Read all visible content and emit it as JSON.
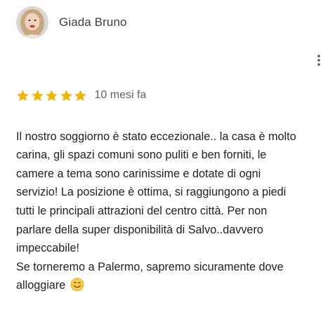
{
  "review": {
    "author": {
      "name": "Giada Bruno",
      "avatar_icon": "user-avatar-photo"
    },
    "rating": {
      "stars": 5,
      "max": 5,
      "star_color": "#f4b400"
    },
    "date": "10 mesi fa",
    "text_lines": [
      "Il nostro soggiorno è stato eccezionale.. la casa è molto",
      "carina, gli spazi comuni sono puliti e ben forniti, le",
      "camere a tema sono carinissime e dotate di ogni",
      "servizio! La posizione è ottima, si raggiungono a piedi",
      "tutti le principali attrazioni del centro città. Per non",
      "parlare della super disponibilità di Salvo..davvero",
      "impeccabile!",
      "Se torneremo a Palermo, sapremo sicuramente dove",
      "alloggiare"
    ],
    "trailing_emoji_icon": "smiling-face-icon",
    "menu_icon": "more-vertical-icon"
  },
  "colors": {
    "text": "#202124",
    "secondary_text": "#5f6368",
    "star": "#f4b400"
  }
}
